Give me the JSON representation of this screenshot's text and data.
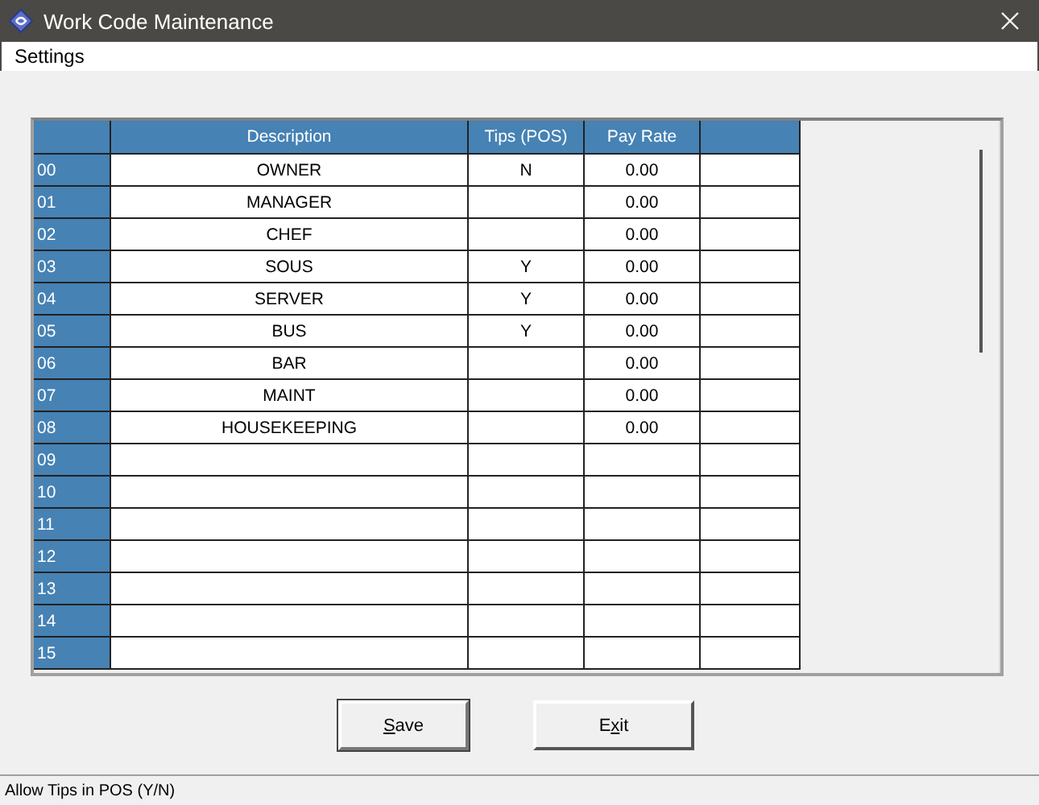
{
  "window": {
    "title": "Work Code Maintenance"
  },
  "menu": [
    "Settings"
  ],
  "table": {
    "columns": [
      "Description",
      "Tips (POS)",
      "Pay Rate"
    ],
    "rows": [
      {
        "code": "00",
        "description": "OWNER",
        "tips": "N",
        "pay_rate": "0.00"
      },
      {
        "code": "01",
        "description": "MANAGER",
        "pay_rate": "0.00"
      },
      {
        "code": "02",
        "description": "CHEF",
        "pay_rate": "0.00"
      },
      {
        "code": "03",
        "description": "SOUS",
        "tips": "Y",
        "pay_rate": "0.00"
      },
      {
        "code": "04",
        "description": "SERVER",
        "tips": "Y",
        "pay_rate": "0.00"
      },
      {
        "code": "05",
        "description": "BUS",
        "tips": "Y",
        "pay_rate": "0.00"
      },
      {
        "code": "06",
        "description": "BAR",
        "pay_rate": "0.00"
      },
      {
        "code": "07",
        "description": "MAINT",
        "pay_rate": "0.00"
      },
      {
        "code": "08",
        "description": "HOUSEKEEPING",
        "pay_rate": "0.00"
      },
      {
        "code": "09"
      },
      {
        "code": "10"
      },
      {
        "code": "11"
      },
      {
        "code": "12"
      },
      {
        "code": "13"
      },
      {
        "code": "14"
      },
      {
        "code": "15"
      }
    ]
  },
  "buttons": [
    {
      "key": "S",
      "after": "ave",
      "focused": true
    },
    {
      "before": "E",
      "key": "x",
      "after": "it",
      "focused": false
    }
  ],
  "status_bar": "Allow Tips in POS (Y/N)"
}
